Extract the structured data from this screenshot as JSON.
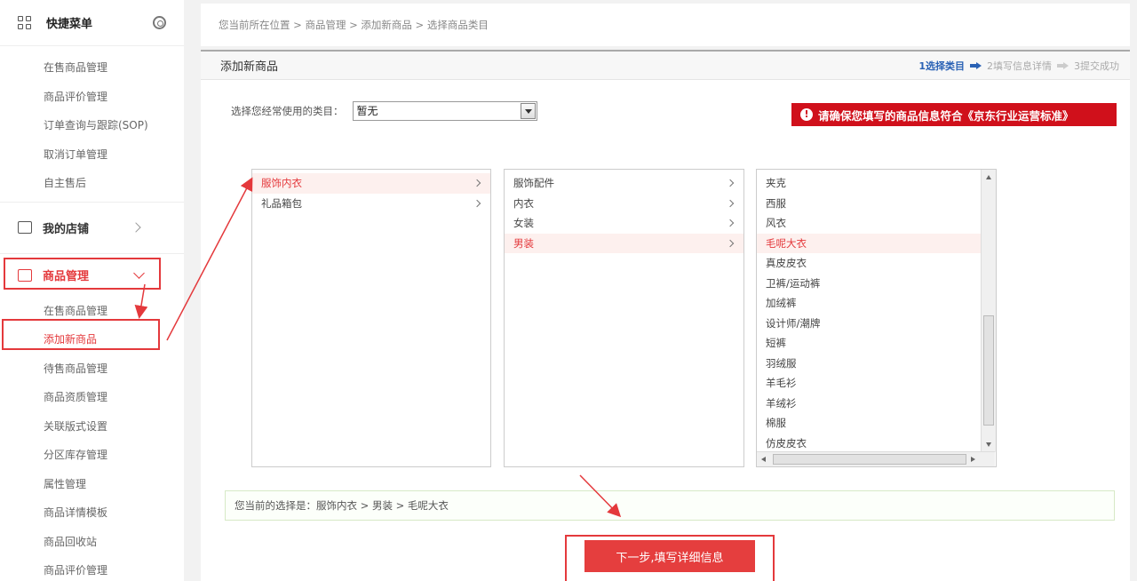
{
  "sidebar": {
    "header_title": "快捷菜单",
    "quick_items": [
      {
        "label": "在售商品管理"
      },
      {
        "label": "商品评价管理"
      },
      {
        "label": "订单查询与跟踪(SOP)"
      },
      {
        "label": "取消订单管理"
      },
      {
        "label": "自主售后"
      }
    ],
    "shop_label": "我的店铺",
    "product_label": "商品管理",
    "product_items": [
      {
        "label": "在售商品管理"
      },
      {
        "label": "添加新商品"
      },
      {
        "label": "待售商品管理"
      },
      {
        "label": "商品资质管理"
      },
      {
        "label": "关联版式设置"
      },
      {
        "label": "分区库存管理"
      },
      {
        "label": "属性管理"
      },
      {
        "label": "商品详情模板"
      },
      {
        "label": "商品回收站"
      },
      {
        "label": "商品评价管理"
      }
    ]
  },
  "breadcrumb": {
    "prefix": "您当前所在位置",
    "items": [
      "商品管理",
      "添加新商品",
      "选择商品类目"
    ],
    "separator": " > "
  },
  "page": {
    "title": "添加新商品",
    "steps": [
      "1选择类目",
      "2填写信息详情",
      "3提交成功"
    ],
    "recent_label": "选择您经常使用的类目：",
    "recent_value": "暂无",
    "warning_text": "请确保您填写的商品信息符合《京东行业运营标准》",
    "current_selection": "您当前的选择是：服饰内衣 > 男装 > 毛呢大衣",
    "next_button": "下一步,填写详细信息"
  },
  "categories": {
    "level1": [
      "服饰内衣",
      "礼品箱包"
    ],
    "level2": [
      "服饰配件",
      "内衣",
      "女装",
      "男装"
    ],
    "level3": [
      "夹克",
      "西服",
      "风衣",
      "毛呢大衣",
      "真皮皮衣",
      "卫裤/运动裤",
      "加绒裤",
      "设计师/潮牌",
      "短裤",
      "羽绒服",
      "羊毛衫",
      "羊绒衫",
      "棉服",
      "仿皮皮衣"
    ]
  },
  "colors": {
    "accent": "#e4393c",
    "warning_bg": "#d0101b",
    "step_current": "#2a62b5"
  }
}
